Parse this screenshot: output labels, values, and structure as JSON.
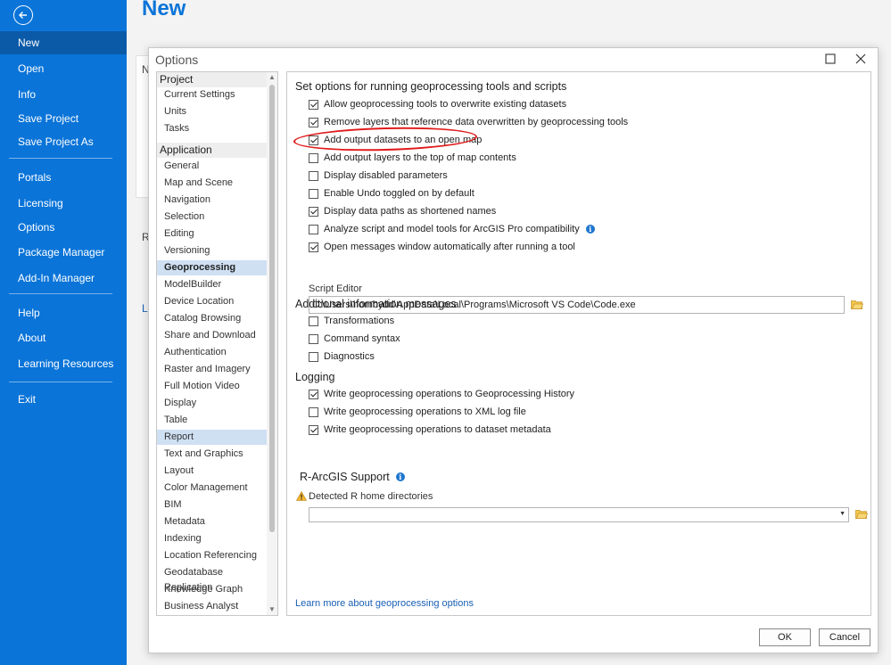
{
  "backstage": {
    "items": [
      {
        "label": "New",
        "active": true
      },
      {
        "label": "Open"
      },
      {
        "label": "Info"
      },
      {
        "label": "Save Project"
      },
      {
        "label": "Save Project As"
      },
      {
        "label": "Portals"
      },
      {
        "label": "Licensing"
      },
      {
        "label": "Options"
      },
      {
        "label": "Package Manager"
      },
      {
        "label": "Add-In Manager"
      },
      {
        "label": "Help"
      },
      {
        "label": "About"
      },
      {
        "label": "Learning Resources"
      },
      {
        "label": "Exit"
      }
    ]
  },
  "main": {
    "title": "New",
    "fragments": [
      "N",
      "R",
      "L"
    ]
  },
  "dialog": {
    "title": "Options",
    "tree": {
      "project_header": "Project",
      "project_items": [
        "Current Settings",
        "Units",
        "Tasks"
      ],
      "application_header": "Application",
      "application_items": [
        "General",
        "Map and Scene",
        "Navigation",
        "Selection",
        "Editing",
        "Versioning",
        "Geoprocessing",
        "ModelBuilder",
        "Device Location",
        "Catalog Browsing",
        "Share and Download",
        "Authentication",
        "Raster and Imagery",
        "Full Motion Video",
        "Display",
        "Table",
        "Report",
        "Text and Graphics",
        "Layout",
        "Color Management",
        "BIM",
        "Metadata",
        "Indexing",
        "Location Referencing",
        "Geodatabase Replication",
        "Knowledge Graph",
        "Business Analyst"
      ],
      "selected": "Geoprocessing",
      "highlighted": "Report"
    },
    "settings": {
      "heading": "Set options for running geoprocessing tools and scripts",
      "options": [
        {
          "label": "Allow geoprocessing tools to overwrite existing datasets",
          "checked": true
        },
        {
          "label": "Remove layers that reference data overwritten by geoprocessing tools",
          "checked": true
        },
        {
          "label": "Add output datasets to an open map",
          "checked": true
        },
        {
          "label": "Add output layers to the top of map contents",
          "checked": false
        },
        {
          "label": "Display disabled parameters",
          "checked": false
        },
        {
          "label": "Enable Undo toggled on by default",
          "checked": false
        },
        {
          "label": "Display data paths as shortened names",
          "checked": true
        },
        {
          "label": "Analyze script and model tools for ArcGIS Pro compatibility",
          "checked": false,
          "info": true
        },
        {
          "label": "Open messages window automatically after running a tool",
          "checked": true
        }
      ],
      "script_editor_label": "Script Editor",
      "script_editor_value": "C:\\Users\\hornbydd\\AppData\\Local\\Programs\\Microsoft VS Code\\Code.exe",
      "additional_heading": "Additional information messages",
      "additional_options": [
        {
          "label": "Transformations",
          "checked": false
        },
        {
          "label": "Command syntax",
          "checked": false
        },
        {
          "label": "Diagnostics",
          "checked": false
        }
      ],
      "logging_heading": "Logging",
      "logging_options": [
        {
          "label": "Write geoprocessing operations to Geoprocessing History",
          "checked": true
        },
        {
          "label": "Write geoprocessing operations to XML log file",
          "checked": false
        },
        {
          "label": "Write geoprocessing operations to dataset metadata",
          "checked": true
        }
      ],
      "rargis_heading": "R-ArcGIS Support",
      "detected_label": "Detected R home directories",
      "r_home_value": "",
      "learn_more": "Learn more about geoprocessing options"
    },
    "buttons": {
      "ok": "OK",
      "cancel": "Cancel"
    }
  },
  "colors": {
    "sidebar": "#0a74d8",
    "sidebar_active": "#0b5aa8",
    "selection": "#cfe0f3",
    "annotation": "#e01b1b",
    "link": "#1a5fb4"
  }
}
